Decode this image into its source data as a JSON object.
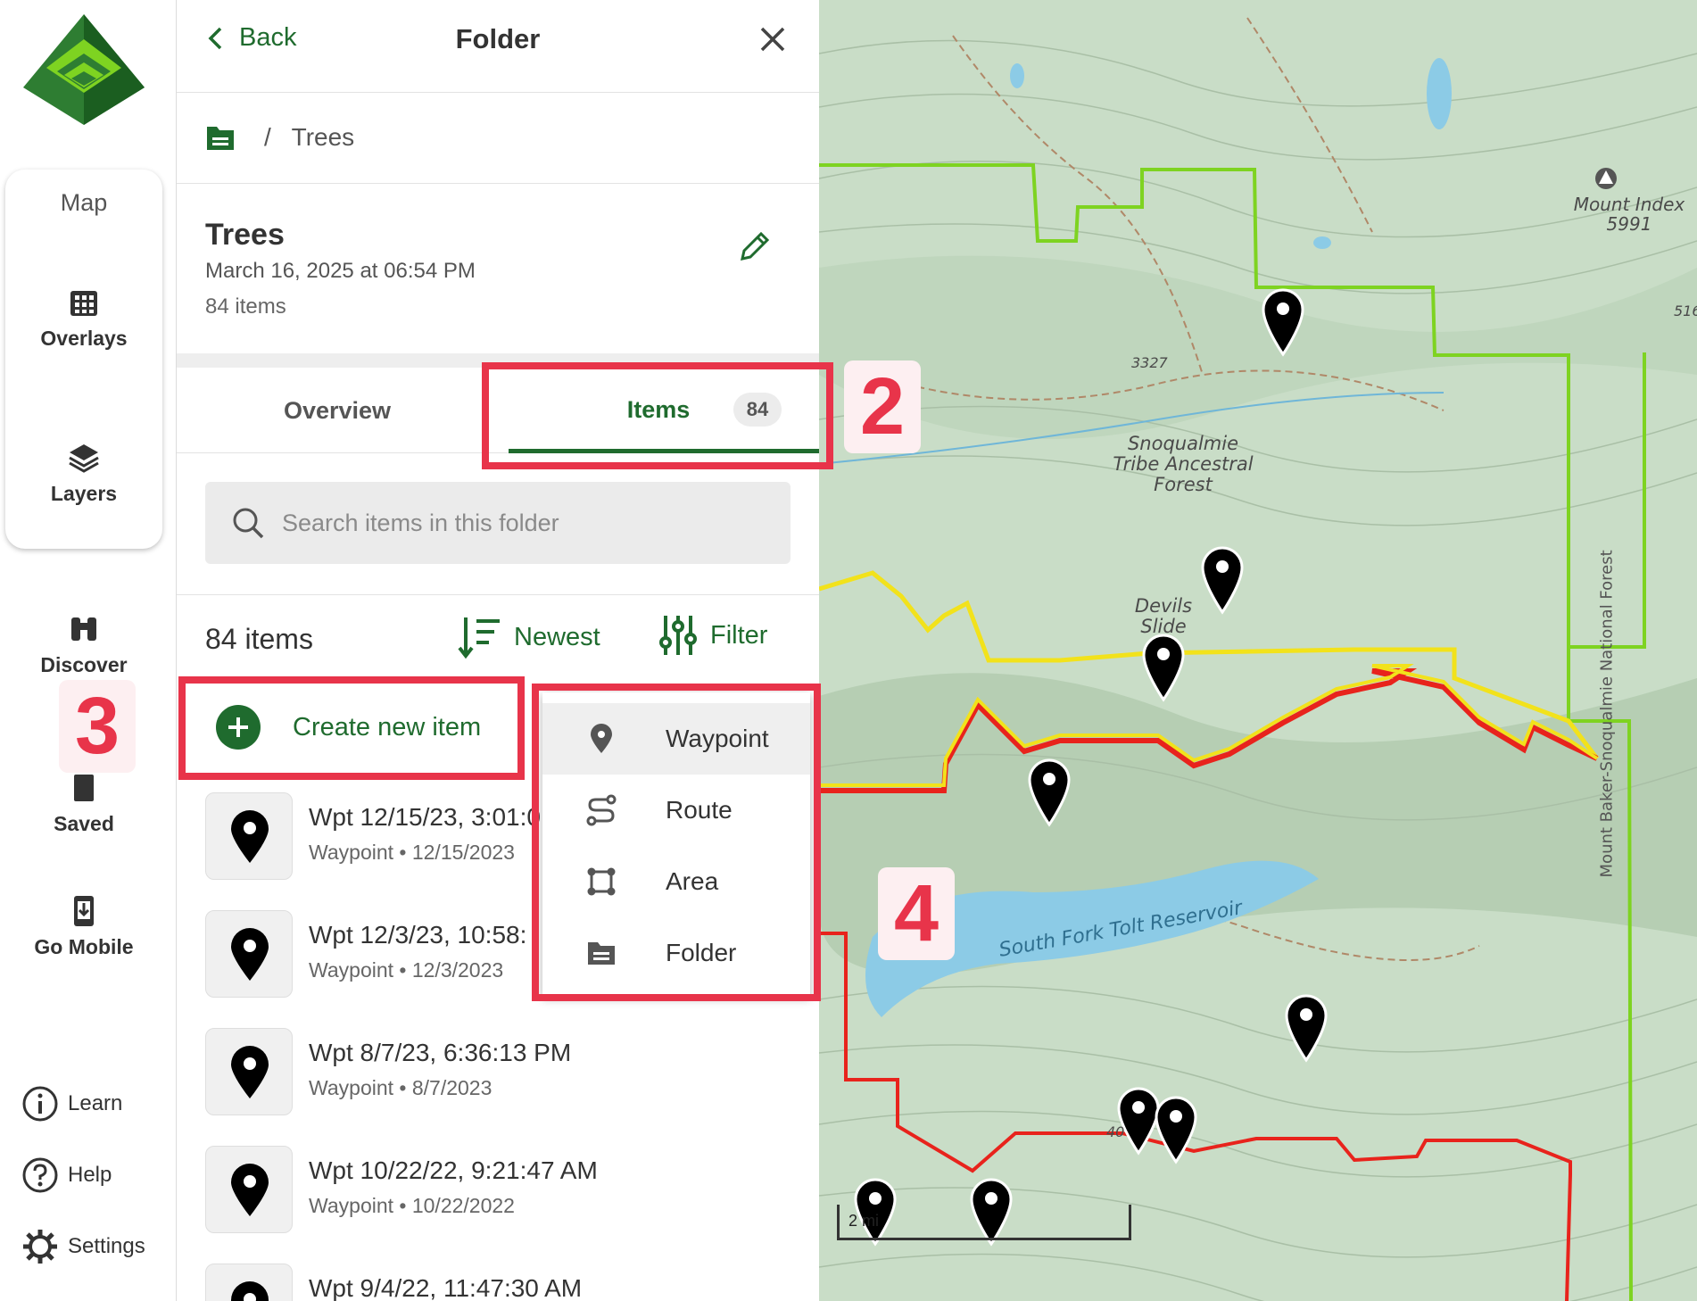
{
  "rail": {
    "map": "Map",
    "overlays": "Overlays",
    "layers": "Layers",
    "discover": "Discover",
    "saved": "Saved",
    "go_mobile": "Go Mobile",
    "learn": "Learn",
    "help": "Help",
    "settings": "Settings"
  },
  "header": {
    "back": "Back",
    "title": "Folder"
  },
  "breadcrumb": {
    "separator": "/",
    "current": "Trees"
  },
  "folder": {
    "name": "Trees",
    "date": "March 16, 2025 at 06:54 PM",
    "count": "84 items"
  },
  "tabs": {
    "overview": "Overview",
    "items": "Items",
    "items_badge": "84"
  },
  "search": {
    "placeholder": "Search items in this folder"
  },
  "list_header": {
    "count": "84 items",
    "sort": "Newest",
    "filter": "Filter"
  },
  "create": {
    "label": "Create new item"
  },
  "items": [
    {
      "title": "Wpt 12/15/23, 3:01:0",
      "subtitle": "Waypoint • 12/15/2023"
    },
    {
      "title": "Wpt 12/3/23, 10:58:",
      "subtitle": "Waypoint • 12/3/2023"
    },
    {
      "title": "Wpt 8/7/23, 6:36:13 PM",
      "subtitle": "Waypoint • 8/7/2023"
    },
    {
      "title": "Wpt 10/22/22, 9:21:47 AM",
      "subtitle": "Waypoint • 10/22/2022"
    },
    {
      "title": "Wpt 9/4/22, 11:47:30 AM",
      "subtitle": ""
    }
  ],
  "menu": {
    "waypoint": "Waypoint",
    "route": "Route",
    "area": "Area",
    "folder": "Folder"
  },
  "annotations": {
    "n2": "2",
    "n3": "3",
    "n4": "4"
  },
  "map": {
    "mount_index": "Mount Index 5991",
    "snoqualmie": "Snoqualmie Tribe Ancestral Forest",
    "devils_slide": "Devils Slide",
    "reservoir": "South Fork Tolt Reservoir",
    "national_forest": "Mount Baker-Snoqualmie National Forest",
    "elev_3327": "3327",
    "elev_516": "516",
    "elev_40": "40",
    "scale": "2 mi"
  },
  "colors": {
    "brand_green": "#1f6b2e",
    "annotation_red": "#e8344a",
    "boundary_green": "#7ed321",
    "trail_yellow": "#f2e21b",
    "trail_red": "#e8231c",
    "water": "#8ccbe6"
  }
}
